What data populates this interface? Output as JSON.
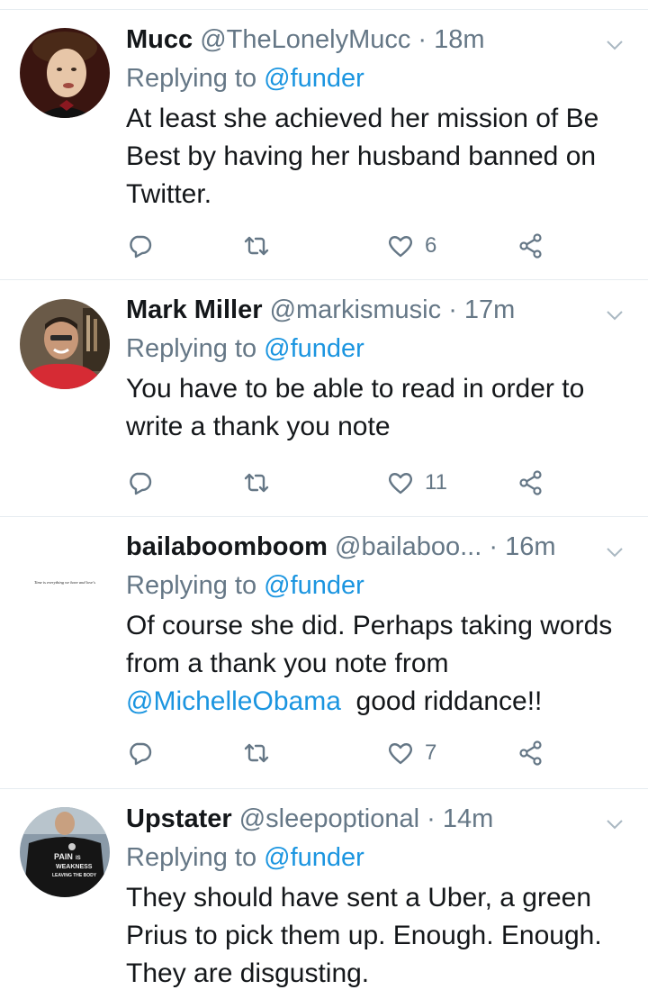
{
  "tweets": [
    {
      "name": "Mucc",
      "handle": "@TheLonelyMucc",
      "time": "18m",
      "reply_prefix": "Replying to",
      "reply_to": "@funder",
      "text": "At least she achieved her mission of Be Best by having her husband banned on Twitter.",
      "likes": "6",
      "avatar": "man-with-bowtie-portrait"
    },
    {
      "name": "Mark Miller",
      "handle": "@markismusic",
      "time": "17m",
      "reply_prefix": "Replying to",
      "reply_to": "@funder",
      "text": "You have to be able to read in order to write a thank you note",
      "likes": "11",
      "avatar": "man-in-red-shirt-portrait"
    },
    {
      "name": "bailaboomboom",
      "handle": "@bailaboo...",
      "time": "16m",
      "reply_prefix": "Replying to",
      "reply_to": "@funder",
      "text_before": "Of course she did.  Perhaps taking words from a thank you note from",
      "text_mention": "@MichelleObama",
      "text_after": "good riddance!!",
      "likes": "7",
      "avatar": "handwritten-text-avatar",
      "avatar_text": "Time is everything we have and love's"
    },
    {
      "name": "Upstater",
      "handle": "@sleepoptional",
      "time": "14m",
      "reply_prefix": "Replying to",
      "reply_to": "@funder",
      "text": "They should have sent a Uber, a green Prius to pick them up.  Enough. Enough.  They are disgusting.",
      "avatar": "black-tshirt-pain-is-weakness",
      "avatar_text": "PAIN IS WEAKNESS LEAVING THE BODY"
    }
  ],
  "colors": {
    "link": "#1b95e0",
    "secondary": "#657786",
    "text": "#14171a",
    "divider": "#e6ecf0"
  },
  "icons": [
    "reply-icon",
    "retweet-icon",
    "like-icon",
    "share-icon",
    "chevron-down-icon"
  ]
}
